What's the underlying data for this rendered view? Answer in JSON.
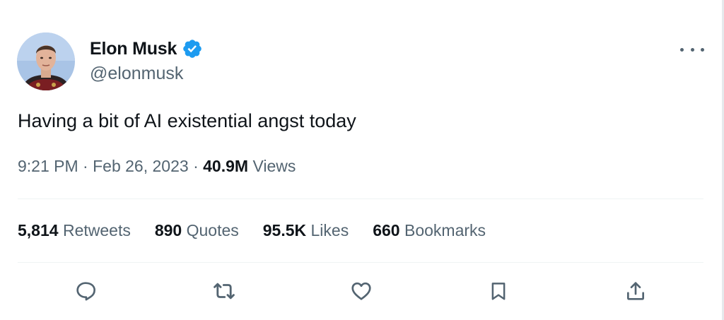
{
  "author": {
    "display_name": "Elon Musk",
    "handle": "@elonmusk",
    "verified": true,
    "verified_color": "#1d9bf0"
  },
  "tweet": {
    "text": "Having a bit of AI existential angst today",
    "time": "9:21 PM",
    "separator": "·",
    "date": "Feb 26, 2023",
    "views_count": "40.9M",
    "views_label": "Views"
  },
  "stats": [
    {
      "count": "5,814",
      "label": "Retweets"
    },
    {
      "count": "890",
      "label": "Quotes"
    },
    {
      "count": "95.5K",
      "label": "Likes"
    },
    {
      "count": "660",
      "label": "Bookmarks"
    }
  ],
  "actions": [
    {
      "icon": "reply-icon"
    },
    {
      "icon": "retweet-icon"
    },
    {
      "icon": "like-icon"
    },
    {
      "icon": "bookmark-icon"
    },
    {
      "icon": "share-icon"
    }
  ],
  "colors": {
    "text_primary": "#0f1419",
    "text_secondary": "#536471",
    "divider": "#eff3f4"
  }
}
